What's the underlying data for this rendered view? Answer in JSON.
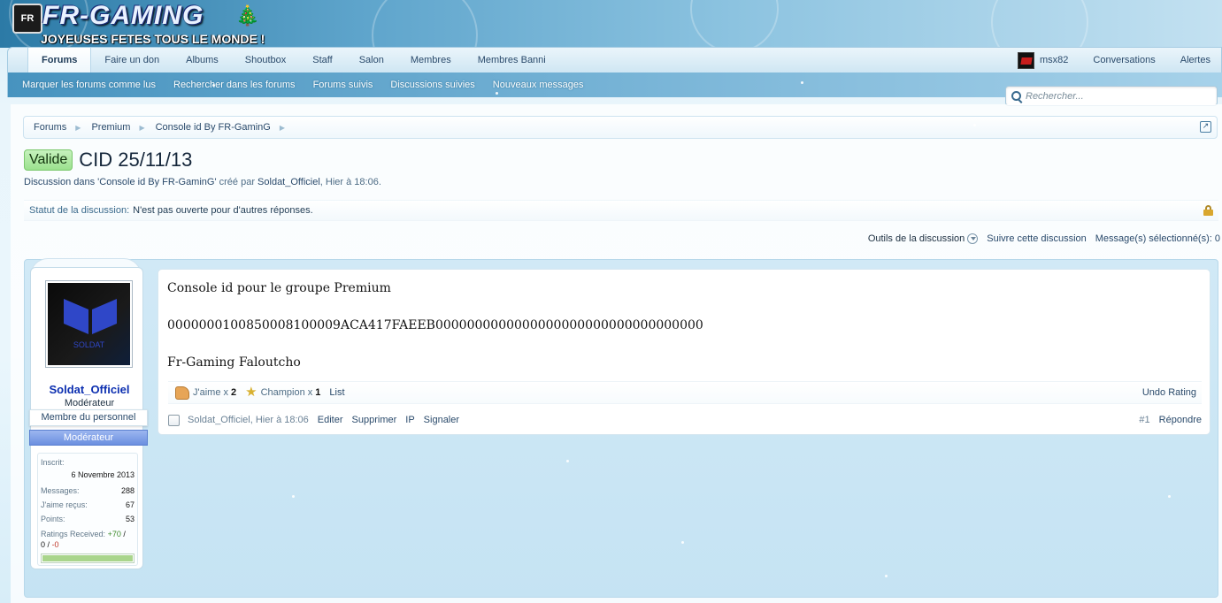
{
  "header": {
    "logo_mark": "FR",
    "logo_text": "FR-GAMING",
    "tagline": "JOYEUSES FETES TOUS LE MONDE !"
  },
  "nav": {
    "tabs": [
      {
        "label": "Forums",
        "active": true
      },
      {
        "label": "Faire un don"
      },
      {
        "label": "Albums"
      },
      {
        "label": "Shoutbox"
      },
      {
        "label": "Staff"
      },
      {
        "label": "Salon"
      },
      {
        "label": "Membres"
      },
      {
        "label": "Membres Banni"
      }
    ],
    "username": "msx82",
    "conversations": "Conversations",
    "alerts": "Alertes"
  },
  "subnav": {
    "links": [
      "Marquer les forums comme lus",
      "Rechercher dans les forums",
      "Forums suivis",
      "Discussions suivies",
      "Nouveaux messages"
    ]
  },
  "search": {
    "placeholder": "Rechercher..."
  },
  "breadcrumb": {
    "items": [
      "Forums",
      "Premium",
      "Console id By FR-GaminG"
    ]
  },
  "thread": {
    "prefix": "Valide",
    "title": "CID 25/11/13",
    "desc_prefix": "Discussion dans",
    "desc_forum": "'Console id By FR-GaminG'",
    "desc_by": "créé par",
    "desc_author": "Soldat_Officiel",
    "desc_time": ", Hier à 18:06.",
    "status_label": "Statut de la discussion:",
    "status_value": "N'est pas ouverte pour d'autres réponses."
  },
  "tools": {
    "thread_tools": "Outils de la discussion",
    "watch": "Suivre cette discussion",
    "selected": "Message(s) sélectionné(s): 0"
  },
  "post": {
    "user": {
      "avatar_text": "SOLDAT",
      "name": "Soldat_Officiel",
      "title": "Modérateur",
      "staff_banner": "Membre du personnel",
      "role_banner": "Modérateur",
      "joined_label": "Inscrit:",
      "joined_value": "6 Novembre 2013",
      "messages_label": "Messages:",
      "messages_value": "288",
      "likes_label": "J'aime reçus:",
      "likes_value": "67",
      "points_label": "Points:",
      "points_value": "53",
      "ratings_label": "Ratings Received:",
      "ratings_pos": "+70",
      "ratings_sep": "/",
      "ratings_zero": "0",
      "ratings_sep2": "/",
      "ratings_neg": "-0",
      "rating_fraction": 1.0
    },
    "body": {
      "line1": "Console id pour le groupe Premium",
      "line2": "0000000100850008100009ACA417FAEEB0000000000000000000000000000000000",
      "line3": "Fr-Gaming Faloutcho"
    },
    "ratings": [
      {
        "label": "J'aime x",
        "count": "2",
        "icon": "thumbs-up-icon"
      },
      {
        "label": "Champion x",
        "count": "1",
        "icon": "star-icon"
      }
    ],
    "list_link": "List",
    "undo_rating": "Undo Rating",
    "meta": {
      "author_time": "Soldat_Officiel, Hier à 18:06",
      "edit": "Editer",
      "delete": "Supprimer",
      "ip": "IP",
      "report": "Signaler",
      "number": "#1",
      "reply": "Répondre"
    }
  },
  "colors": {
    "header_dark": "#2c7aa6",
    "link": "#2a4a6b",
    "username": "#0c2fb0",
    "prefix_green": "#9be18e",
    "mod_banner": "#6b8fe0"
  }
}
